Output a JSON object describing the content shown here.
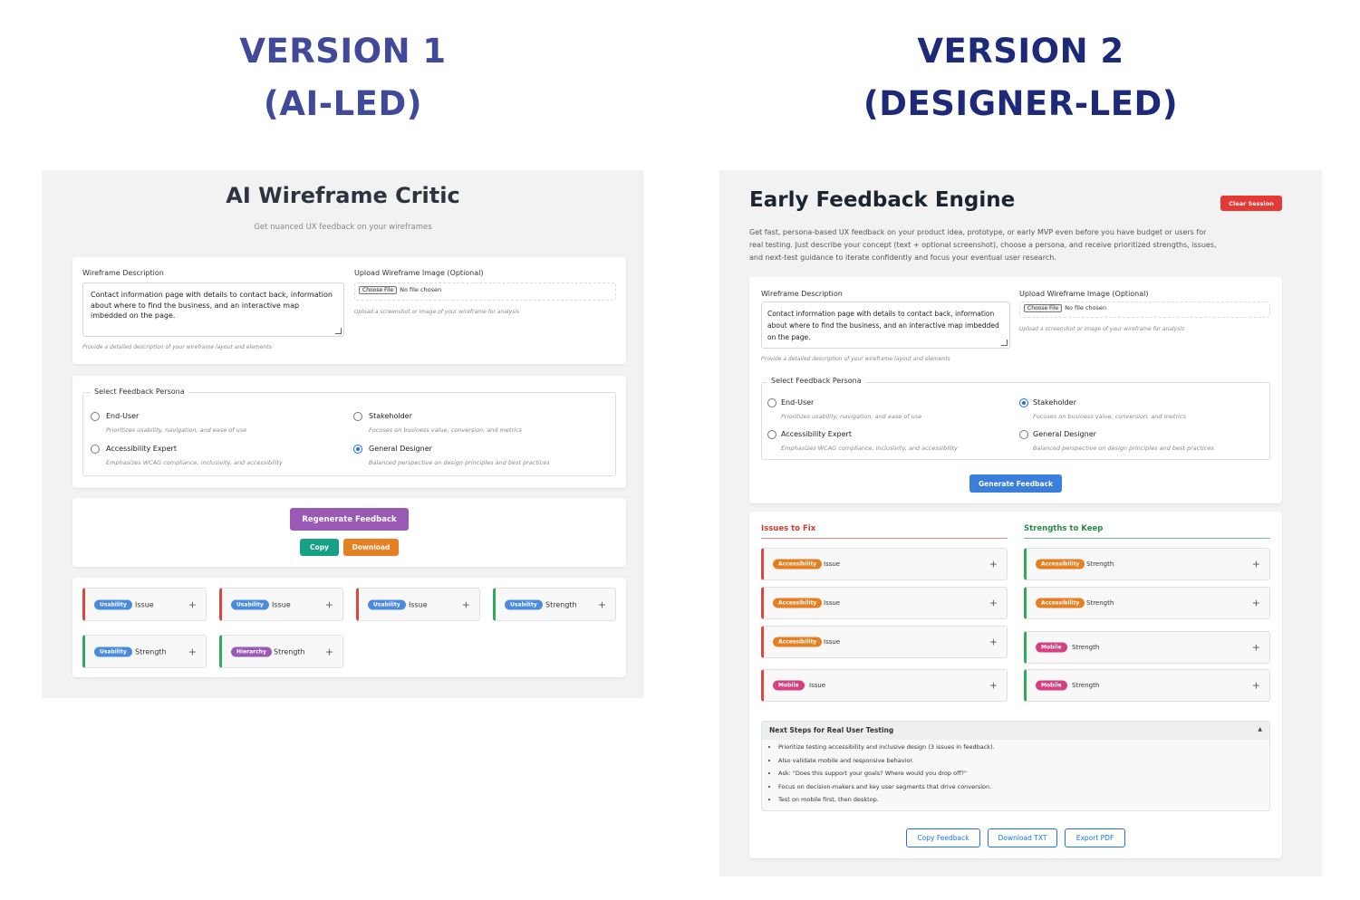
{
  "version1": {
    "heading_line1": "VERSION 1",
    "heading_line2": "(AI-LED)",
    "app_title": "AI Wireframe Critic",
    "subtitle": "Get nuanced UX feedback on your wireframes",
    "wireframe_label": "Wireframe Description",
    "wireframe_text": "Contact information page with details to contact back, information about where to find the business, and an interactive map imbedded on the page.",
    "wireframe_help": "Provide a detailed description of your wireframe layout and elements",
    "upload_label": "Upload Wireframe Image (Optional)",
    "choose_file": "Choose File",
    "no_file": "No file chosen",
    "upload_help": "Upload a screenshot or image of your wireframe for analysis",
    "persona_legend": "Select Feedback Persona",
    "personas": [
      {
        "name": "End-User",
        "desc": "Prioritizes usability, navigation, and ease of use"
      },
      {
        "name": "Stakeholder",
        "desc": "Focuses on business value, conversion, and metrics"
      },
      {
        "name": "Accessibility Expert",
        "desc": "Emphasizes WCAG compliance, inclusivity, and accessibility"
      },
      {
        "name": "General Designer",
        "desc": "Balanced perspective on design principles and best practices"
      }
    ],
    "selected_persona": "General Designer",
    "regenerate_label": "Regenerate Feedback",
    "copy_label": "Copy",
    "download_label": "Download",
    "feedback": [
      {
        "tag": "Usability",
        "text": "Issue"
      },
      {
        "tag": "Usability",
        "text": "Issue"
      },
      {
        "tag": "Usability",
        "text": "Issue"
      },
      {
        "tag": "Usability",
        "text": "Strength"
      },
      {
        "tag": "Usability",
        "text": "Strength"
      },
      {
        "tag": "Hierarchy",
        "text": "Strength"
      }
    ],
    "plus": "+"
  },
  "version2": {
    "heading_line1": "VERSION 2",
    "heading_line2": "(DESIGNER-LED)",
    "app_title": "Early Feedback Engine",
    "clear_session": "Clear Session",
    "intro": "Get fast, persona-based UX feedback on your product idea, prototype, or early MVP even before you have budget or users for real testing. Just describe your concept (text + optional screenshot), choose a persona, and receive prioritized strengths, issues, and next-test guidance to iterate confidently and focus your eventual user research.",
    "wireframe_label": "Wireframe Description",
    "wireframe_text": "Contact information page with details to contact back, information about where to find the business, and an interactive map imbedded on the page.",
    "wireframe_help": "Provide a detailed description of your wireframe layout and elements",
    "upload_label": "Upload Wireframe Image (Optional)",
    "choose_file": "Choose File",
    "no_file": "No file chosen",
    "upload_help": "Upload a screenshot or image of your wireframe for analysis",
    "persona_legend": "Select Feedback Persona",
    "personas": [
      {
        "name": "End-User",
        "desc": "Prioritizes usability, navigation, and ease of use"
      },
      {
        "name": "Stakeholder",
        "desc": "Focuses on business value, conversion, and metrics"
      },
      {
        "name": "Accessibility Expert",
        "desc": "Emphasizes WCAG compliance, inclusivity, and accessibility"
      },
      {
        "name": "General Designer",
        "desc": "Balanced perspective on design principles and best practices"
      }
    ],
    "selected_persona": "Stakeholder",
    "generate_label": "Generate Feedback",
    "issues_heading": "Issues to Fix",
    "strengths_heading": "Strengths to Keep",
    "issues": [
      {
        "tag": "Accessibility",
        "text": "Issue"
      },
      {
        "tag": "Accessibility",
        "text": "Issue"
      },
      {
        "tag": "Accessibility",
        "text": "Issue"
      },
      {
        "tag": "Mobile",
        "text": "Issue"
      }
    ],
    "strengths": [
      {
        "tag": "Accessibility",
        "text": "Strength"
      },
      {
        "tag": "Accessibility",
        "text": "Strength"
      },
      {
        "tag": "Mobile",
        "text": "Strength"
      },
      {
        "tag": "Mobile",
        "text": "Strength"
      }
    ],
    "plus": "+",
    "next_steps_title": "Next Steps for Real User Testing",
    "collapse_glyph": "▲",
    "next_steps": [
      "Prioritize testing accessibility and inclusive design (3 issues in feedback).",
      "Also validate mobile and responsive behavior.",
      "Ask: \"Does this support your goals? Where would you drop off?\"",
      "Focus on decision-makers and key user segments that drive conversion.",
      "Test on mobile first, then desktop."
    ],
    "copy_feedback": "Copy Feedback",
    "download_txt": "Download TXT",
    "export_pdf": "Export PDF"
  },
  "colors": {
    "v1_heading": "#414a9a",
    "v2_heading": "#1d2a7a",
    "issue_border": "#e0453a",
    "strength_border": "#2faa5a",
    "tag_usability": "#4a8bdf",
    "tag_hierarchy": "#9b59b6",
    "tag_accessibility": "#e67e22",
    "tag_mobile": "#d63f80",
    "regenerate": "#9b59b6",
    "copy": "#16a085",
    "download": "#e67e22",
    "generate": "#3a7fdc",
    "clear_session": "#e53935"
  }
}
